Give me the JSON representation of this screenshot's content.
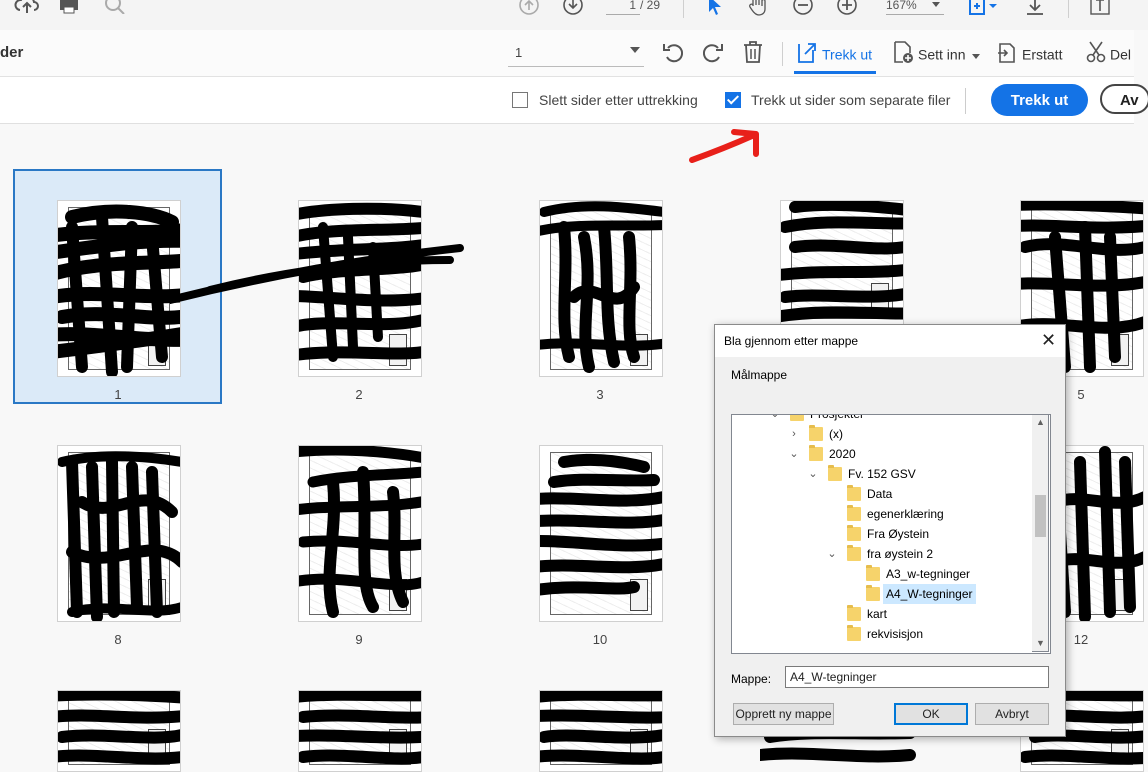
{
  "topbar": {
    "page_current": "1",
    "page_total": "/ 29",
    "zoom": "167%"
  },
  "toolbar2": {
    "title_partial": "der",
    "page_select_value": "1",
    "tools": {
      "extract": "Trekk ut",
      "insert": "Sett inn",
      "replace": "Erstatt",
      "split": "Del"
    }
  },
  "options": {
    "delete_after": {
      "label": "Slett sider etter uttrekking",
      "checked": false
    },
    "separate_files": {
      "label": "Trekk ut sider som separate filer",
      "checked": true
    },
    "extract_button": "Trekk ut",
    "cancel_button": "Av"
  },
  "thumbnails": [
    {
      "label": "1"
    },
    {
      "label": "2"
    },
    {
      "label": "3"
    },
    {
      "label": "5"
    },
    {
      "label": "8"
    },
    {
      "label": "9"
    },
    {
      "label": "10"
    },
    {
      "label": "12"
    }
  ],
  "dialog": {
    "title": "Bla gjennom etter mappe",
    "close": "✕",
    "target_label": "Målmappe",
    "tree": [
      {
        "text": "Prosjekter",
        "expander": "⌄"
      },
      {
        "text": "(x)",
        "expander": "›"
      },
      {
        "text": "2020",
        "expander": "⌄"
      },
      {
        "text": "Fv. 152 GSV",
        "expander": "⌄"
      },
      {
        "text": "Data",
        "expander": ""
      },
      {
        "text": "egenerklæring",
        "expander": ""
      },
      {
        "text": "Fra Øystein",
        "expander": ""
      },
      {
        "text": "fra øystein 2",
        "expander": "⌄"
      },
      {
        "text": "A3_w-tegninger",
        "expander": ""
      },
      {
        "text": "A4_W-tegninger",
        "expander": "",
        "selected": true
      },
      {
        "text": "kart",
        "expander": ""
      },
      {
        "text": "rekvisisjon",
        "expander": ""
      }
    ],
    "folder_label": "Mappe:",
    "folder_value": "A4_W-tegninger",
    "new_folder_button": "Opprett ny mappe",
    "ok_button": "OK",
    "cancel_button": "Avbryt"
  },
  "colors": {
    "accent": "#1473e6",
    "selection": "#dbeaf8",
    "annotation_arrow": "#e8201a"
  }
}
